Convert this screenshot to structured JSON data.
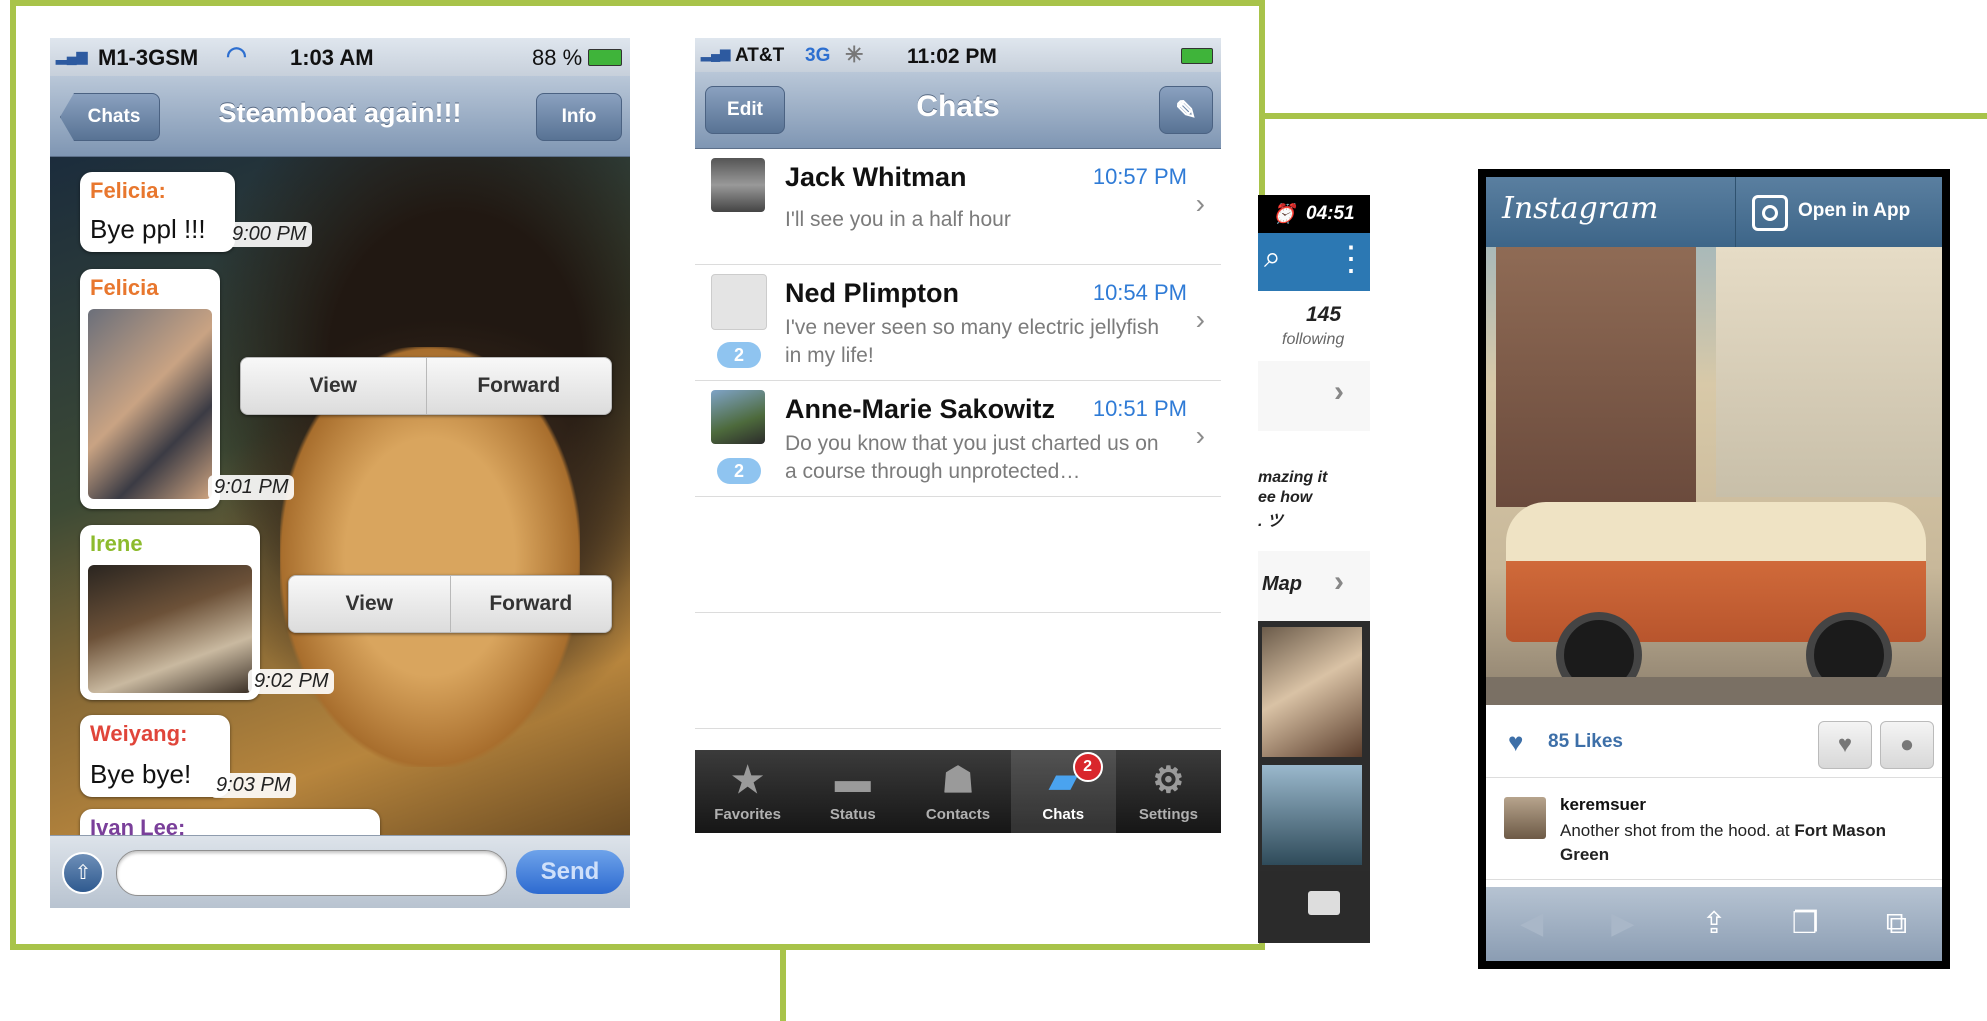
{
  "chat_screen": {
    "status": {
      "carrier": "M1-3GSM",
      "time": "1:03 AM",
      "battery": "88 %"
    },
    "nav": {
      "back_label": "Chats",
      "title": "Steamboat again!!!",
      "info_label": "Info"
    },
    "messages": [
      {
        "sender": "Felicia:",
        "text": "Bye ppl !!!",
        "time": "9:00 PM",
        "color": "#e8772e"
      },
      {
        "sender": "Felicia",
        "time": "9:01 PM",
        "color": "#e8772e"
      },
      {
        "sender": "Irene",
        "time": "9:02 PM",
        "color": "#8dbb2d"
      },
      {
        "sender": "Weiyang:",
        "text": "Bye bye!",
        "time": "9:03 PM",
        "color": "#e0453a"
      },
      {
        "sender": "Ivan Lee:",
        "color": "#7a3f9a"
      }
    ],
    "actions": {
      "view_label": "View",
      "forward_label": "Forward"
    },
    "input": {
      "send_label": "Send",
      "placeholder": ""
    }
  },
  "chats_screen": {
    "status": {
      "carrier": "AT&T",
      "network": "3G",
      "time": "11:02 PM"
    },
    "nav": {
      "edit_label": "Edit",
      "title": "Chats"
    },
    "rows": [
      {
        "name": "Jack Whitman",
        "time": "10:57 PM",
        "preview": "I'll see you in a half hour",
        "unread": ""
      },
      {
        "name": "Ned Plimpton",
        "time": "10:54 PM",
        "preview": "I've never seen so many electric jellyfish in my life!",
        "unread": "2"
      },
      {
        "name": "Anne-Marie Sakowitz",
        "time": "10:51 PM",
        "preview": "Do you know that you just charted us on a course through unprotected…",
        "unread": "2"
      }
    ],
    "tabs": [
      {
        "label": "Favorites",
        "icon": "star-icon"
      },
      {
        "label": "Status",
        "icon": "speech-bubble-icon"
      },
      {
        "label": "Contacts",
        "icon": "person-icon"
      },
      {
        "label": "Chats",
        "icon": "chat-bubbles-icon",
        "badge": "2"
      },
      {
        "label": "Settings",
        "icon": "gear-icon"
      }
    ]
  },
  "partial_screen": {
    "time": "04:51",
    "following_count": "145",
    "following_label": "following",
    "snippet_line1": "mazing it",
    "snippet_line2": "ee how",
    "snippet_line3": ". ツ",
    "map_label": "Map"
  },
  "instagram_screen": {
    "logo": "Instagram",
    "open_label": "Open in App",
    "likes": "85 Likes",
    "user": "keremsuer",
    "caption_prefix": "Another shot from the hood. at ",
    "location": "Fort Mason Green"
  },
  "colors": {
    "frame": "#a8c34a",
    "ios_blue": "#2f7bd6",
    "instagram_blue": "#3d6588"
  }
}
